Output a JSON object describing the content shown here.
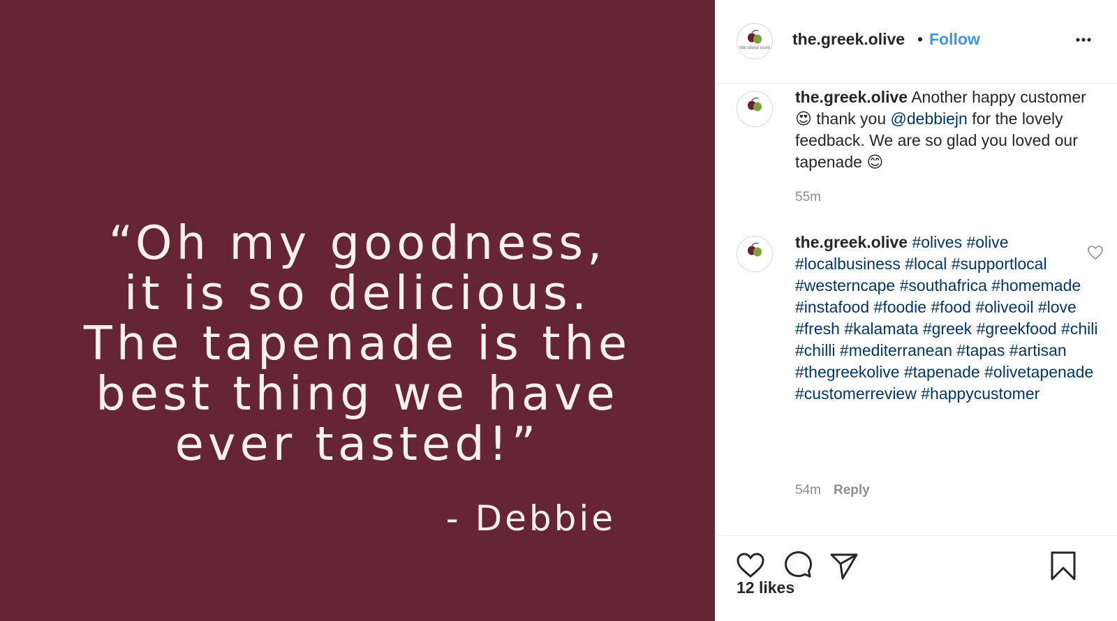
{
  "post": {
    "quote_lines": [
      "“Oh my goodness,",
      "it is so delicious.",
      "The tapenade is the",
      "best thing we have",
      "ever tasted!”"
    ],
    "author": "- Debbie",
    "background_color": "#652532",
    "text_color": "#fbf1ea"
  },
  "header": {
    "username": "the.greek.olive",
    "separator": "•",
    "follow_label": "Follow",
    "avatar_text": "THE GREEK OLIVE"
  },
  "caption": {
    "username": "the.greek.olive",
    "text_1": " Another happy customer ",
    "emoji_1": "😍",
    "text_2": " thank you ",
    "mention": "@debbiejn",
    "text_3": " for the lovely feedback. We are so glad you loved our tapenade ",
    "emoji_2": "😊",
    "time": "55m"
  },
  "comment": {
    "username": "the.greek.olive",
    "hashtags": [
      "#olives",
      "#olive",
      "#localbusiness",
      "#local",
      "#supportlocal",
      "#westerncape",
      "#southafrica",
      "#homemade",
      "#instafood",
      "#foodie",
      "#food",
      "#oliveoil",
      "#love",
      "#fresh",
      "#kalamata",
      "#greek",
      "#greekfood",
      "#chili",
      "#chilli",
      "#mediterranean",
      "#tapas",
      "#artisan",
      "#thegreekolive",
      "#tapenade",
      "#olivetapenade",
      "#customerreview",
      "#happycustomer"
    ],
    "time": "54m",
    "reply_label": "Reply"
  },
  "actions": {
    "like_icon": "heart-icon",
    "comment_icon": "comment-bubble-icon",
    "share_icon": "paper-plane-icon",
    "save_icon": "bookmark-icon",
    "likes_label": "12 likes"
  },
  "colors": {
    "link": "#00376b",
    "follow": "#3897f0",
    "muted": "#8e8e8e"
  }
}
